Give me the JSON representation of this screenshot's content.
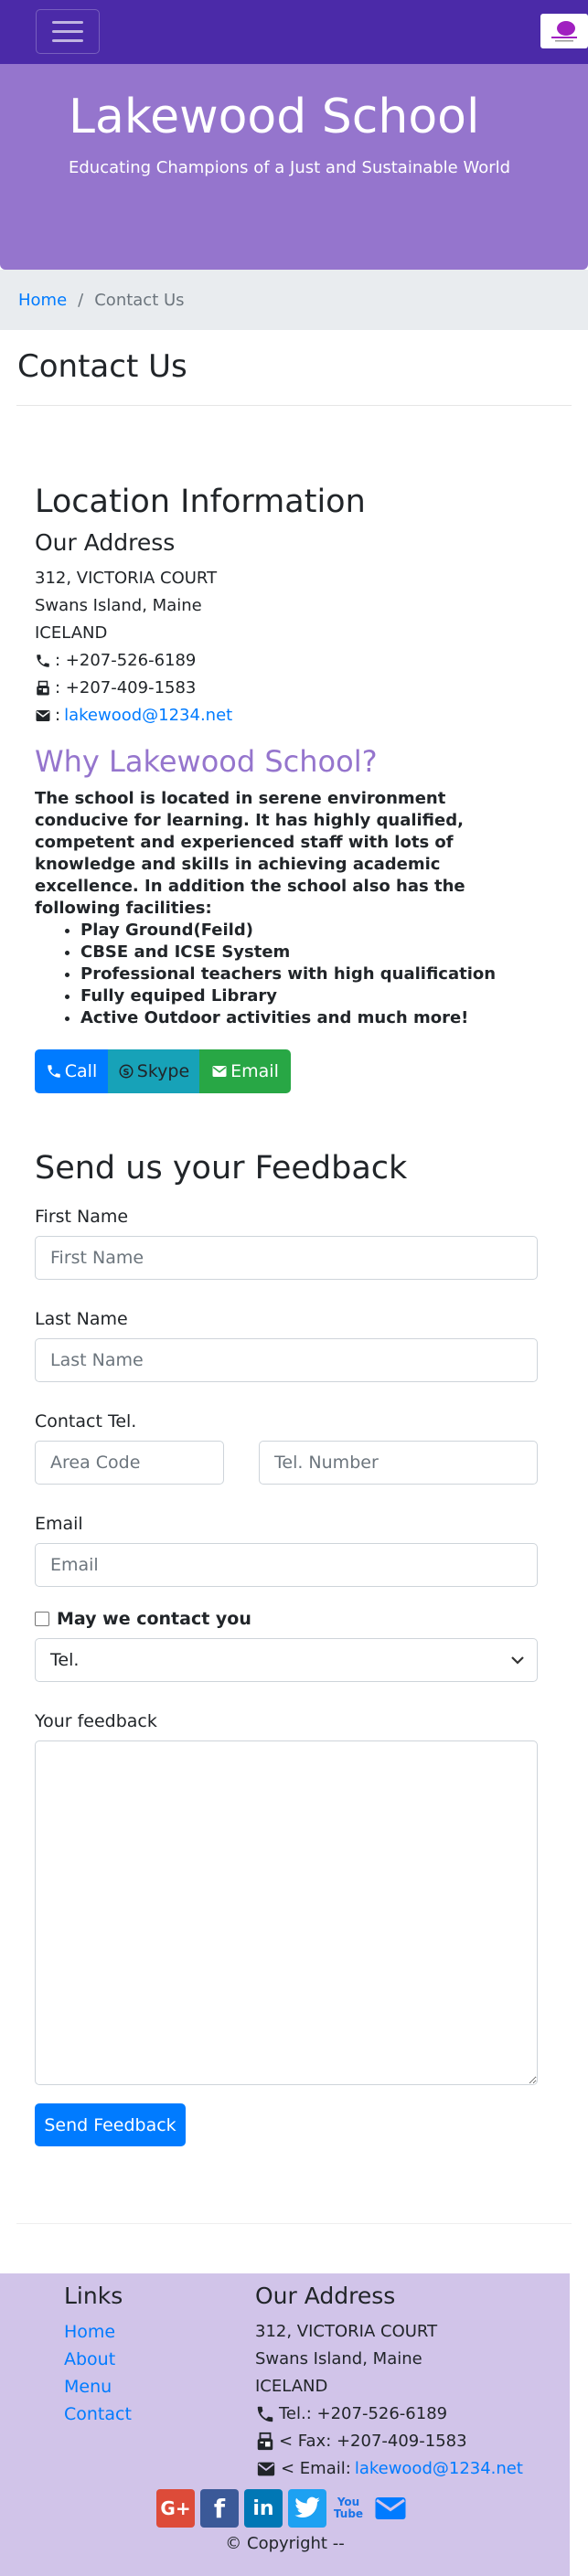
{
  "navbar": {
    "menu_icon": "hamburger-icon",
    "logo": "school-logo"
  },
  "jumbotron": {
    "title": "Lakewood School",
    "subtitle": "Educating Champions of a Just and Sustainable World"
  },
  "breadcrumb": {
    "home": "Home",
    "separator": "/",
    "current": "Contact Us"
  },
  "page_title": "Contact Us",
  "location": {
    "heading": "Location Information",
    "subheading": "Our Address",
    "lines": [
      "312, VICTORIA COURT",
      "Swans Island, Maine",
      "ICELAND"
    ],
    "phone": ": +207-526-6189",
    "fax": ": +207-409-1583",
    "email_sep": ":",
    "email": "lakewood@1234.net"
  },
  "why": {
    "heading": "Why Lakewood School?",
    "description": "The school is located in serene environment conducive for learning. It has highly qualified, competent and experienced staff with lots of knowledge and skills in achieving academic excellence. In addition the school also has the following facilities:",
    "facilities": [
      "Play Ground(Feild)",
      "CBSE and ICSE System",
      "Professional teachers with high qualification",
      "Fully equiped Library",
      "Active Outdoor activities and much more!"
    ]
  },
  "buttons": {
    "call": "Call",
    "skype": "Skype",
    "email": "Email"
  },
  "feedback": {
    "heading": "Send us your Feedback",
    "first_name_label": "First Name",
    "first_name_placeholder": "First Name",
    "last_name_label": "Last Name",
    "last_name_placeholder": "Last Name",
    "tel_label": "Contact Tel.",
    "area_code_placeholder": "Area Code",
    "tel_number_placeholder": "Tel. Number",
    "email_label": "Email",
    "email_placeholder": "Email",
    "contact_check": "May we contact you",
    "contact_method": "Tel.",
    "feedback_label": "Your feedback",
    "submit": "Send Feedback"
  },
  "footer": {
    "links_heading": "Links",
    "links": [
      "Home",
      "About",
      "Menu",
      "Contact"
    ],
    "address_heading": "Our Address",
    "lines": [
      "312, VICTORIA COURT",
      "Swans Island, Maine",
      "ICELAND"
    ],
    "tel": "Tel.: +207-526-6189",
    "fax": "< Fax: +207-409-1583",
    "email_prefix": "< Email:",
    "email": "lakewood@1234.net",
    "copyright": "© Copyright --"
  },
  "social": [
    {
      "name": "google-plus-icon",
      "label": "G+",
      "color": "#dd4b39"
    },
    {
      "name": "facebook-icon",
      "label": "f",
      "color": "#3b5998"
    },
    {
      "name": "linkedin-icon",
      "label": "in",
      "color": "#0077b5"
    },
    {
      "name": "twitter-icon",
      "label": "twitter",
      "color": "#1da1f2"
    },
    {
      "name": "youtube-icon",
      "label": "You Tube",
      "color": "#1a73e8"
    },
    {
      "name": "mail-icon",
      "label": "mail",
      "color": "#007bff"
    }
  ],
  "colors": {
    "navbar": "#4b2aa8",
    "jumbotron": "#9575cd",
    "footer": "#d1c4e9",
    "primary": "#007bff",
    "info": "#17a2b8",
    "success": "#28a745"
  }
}
